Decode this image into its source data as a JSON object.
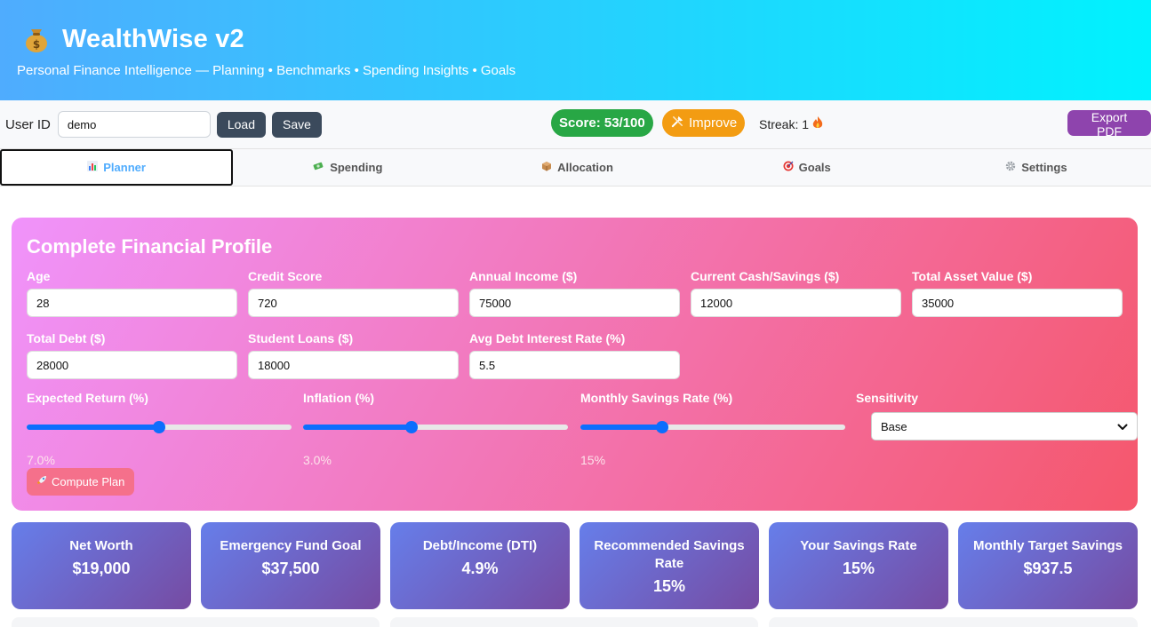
{
  "app": {
    "title": "WealthWise v2",
    "subtitle": "Personal Finance Intelligence — Planning • Benchmarks • Spending Insights • Goals",
    "logo_icon": "money-bag-icon"
  },
  "toolbar": {
    "user_id_label": "User ID",
    "user_id_value": "demo",
    "load_label": "Load",
    "save_label": "Save",
    "score_label": "Score: 53/100",
    "improve_label": "Improve",
    "streak_label": "Streak: 1",
    "export_label": "Export PDF"
  },
  "tabs": [
    {
      "label": "Planner",
      "icon": "chart-icon",
      "active": true
    },
    {
      "label": "Spending",
      "icon": "money-icon",
      "active": false
    },
    {
      "label": "Allocation",
      "icon": "box-icon",
      "active": false
    },
    {
      "label": "Goals",
      "icon": "target-icon",
      "active": false
    },
    {
      "label": "Settings",
      "icon": "gear-icon",
      "active": false
    }
  ],
  "profile": {
    "title": "Complete Financial Profile",
    "fields": [
      {
        "label": "Age",
        "value": "28"
      },
      {
        "label": "Credit Score",
        "value": "720"
      },
      {
        "label": "Annual Income ($)",
        "value": "75000"
      },
      {
        "label": "Current Cash/Savings ($)",
        "value": "12000"
      },
      {
        "label": "Total Asset Value ($)",
        "value": "35000"
      },
      {
        "label": "Total Debt ($)",
        "value": "28000"
      },
      {
        "label": "Student Loans ($)",
        "value": "18000"
      },
      {
        "label": "Avg Debt Interest Rate (%)",
        "value": "5.5"
      }
    ],
    "sliders": [
      {
        "label": "Expected Return (%)",
        "value": "7.0%",
        "fraction": 0.5
      },
      {
        "label": "Inflation (%)",
        "value": "3.0%",
        "fraction": 0.41
      },
      {
        "label": "Monthly Savings Rate (%)",
        "value": "15%",
        "fraction": 0.31
      }
    ],
    "sensitivity": {
      "label": "Sensitivity",
      "value": "Base"
    },
    "compute_label": "Compute Plan"
  },
  "metrics": [
    {
      "label": "Net Worth",
      "value": "$19,000"
    },
    {
      "label": "Emergency Fund Goal",
      "value": "$37,500"
    },
    {
      "label": "Debt/Income (DTI)",
      "value": "4.9%"
    },
    {
      "label": "Recommended Savings Rate",
      "value": "15%"
    },
    {
      "label": "Your Savings Rate",
      "value": "15%"
    },
    {
      "label": "Monthly Target Savings",
      "value": "$937.5"
    }
  ],
  "colors": {
    "header_gradient_start": "#4facfe",
    "header_gradient_end": "#00f2fe",
    "score_green": "#28a745",
    "improve_orange": "#f39c12",
    "export_purple": "#8e44ad",
    "profile_gradient_start": "#f093fb",
    "profile_gradient_end": "#f5576c",
    "metric_gradient_start": "#667eea",
    "metric_gradient_end": "#764ba2",
    "slider_blue": "#0d6efd"
  }
}
